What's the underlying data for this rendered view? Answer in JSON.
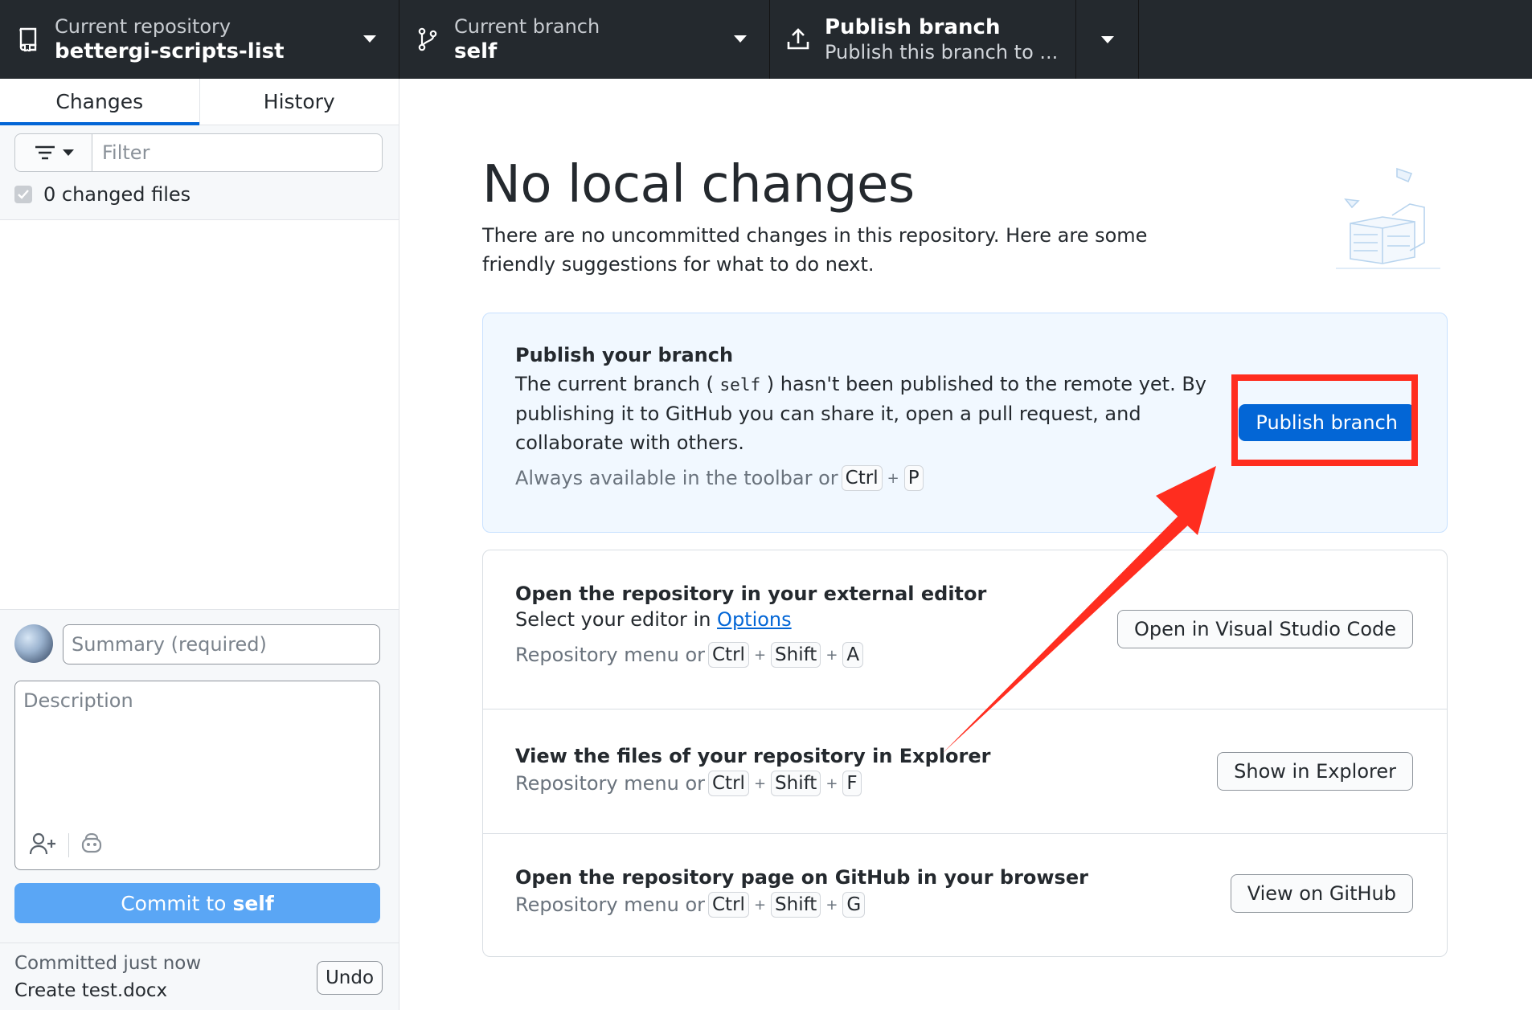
{
  "toolbar": {
    "repo": {
      "label": "Current repository",
      "value": "bettergi-scripts-list",
      "icon": "repo-icon"
    },
    "branch": {
      "label": "Current branch",
      "value": "self",
      "icon": "git-branch-icon"
    },
    "publish": {
      "label": "Publish branch",
      "sub": "Publish this branch to ...",
      "icon": "upload-icon"
    }
  },
  "sidebar": {
    "tabs": [
      {
        "label": "Changes",
        "active": true
      },
      {
        "label": "History",
        "active": false
      }
    ],
    "filter": {
      "placeholder": "Filter"
    },
    "changed_files": "0 changed files",
    "commit": {
      "summary_placeholder": "Summary (required)",
      "description_placeholder": "Description",
      "button_prefix": "Commit to",
      "button_branch": "self"
    },
    "last_commit": {
      "title": "Committed just now",
      "message": "Create test.docx",
      "undo": "Undo"
    }
  },
  "main": {
    "title": "No local changes",
    "subtitle": "There are no uncommitted changes in this repository. Here are some friendly suggestions for what to do next.",
    "publish_card": {
      "title": "Publish your branch",
      "text_before": "The current branch (",
      "branch_code": "self",
      "text_after": ") hasn't been published to the remote yet. By publishing it to GitHub you can share it, open a pull request, and collaborate with others.",
      "hint": "Always available in the toolbar or",
      "keys": [
        "Ctrl",
        "P"
      ],
      "button": "Publish branch"
    },
    "editor_item": {
      "title": "Open the repository in your external editor",
      "text_prefix": "Select your editor in",
      "link": "Options",
      "hint": "Repository menu or",
      "keys": [
        "Ctrl",
        "Shift",
        "A"
      ],
      "button": "Open in Visual Studio Code"
    },
    "explorer_item": {
      "title": "View the files of your repository in Explorer",
      "hint": "Repository menu or",
      "keys": [
        "Ctrl",
        "Shift",
        "F"
      ],
      "button": "Show in Explorer"
    },
    "github_item": {
      "title": "Open the repository page on GitHub in your browser",
      "hint": "Repository menu or",
      "keys": [
        "Ctrl",
        "Shift",
        "G"
      ],
      "button": "View on GitHub"
    }
  },
  "colors": {
    "accent": "#0366d6",
    "toolbar": "#24292e",
    "annotation": "#ff2d1f",
    "commit_button": "#5aa6f5"
  }
}
